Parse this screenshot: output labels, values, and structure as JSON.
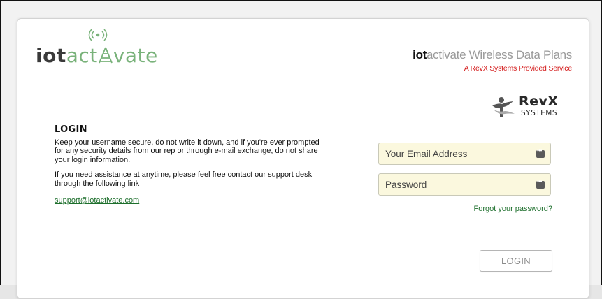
{
  "logo": {
    "part1": "iot",
    "part2": "act",
    "part3": "vate"
  },
  "brand": {
    "bold": "iot",
    "light": "activate Wireless Data Plans",
    "tagline": "A RevX Systems Provided Service",
    "partner_name": "RevX",
    "partner_sub": "SYSTEMS"
  },
  "info": {
    "title": "LOGIN",
    "paragraph1": "Keep your username secure, do not write it down, and if you're ever prompted for any security details from our rep or through e-mail exchange, do not share your login information.",
    "paragraph2": "If you need assistance at anytime, please feel free contact our support desk through the following link",
    "support_link": "support@iotactivate.com"
  },
  "form": {
    "email_placeholder": "Your Email Address",
    "email_value": "",
    "password_placeholder": "Password",
    "password_value": "",
    "forgot_link": "Forgot your password?",
    "login_button": "LOGIN"
  },
  "icons": {
    "field_icon": "keyboard-autofill-icon",
    "logo_icon": "signal-tower-icon",
    "partner_icon": "revx-figure-icon"
  },
  "colors": {
    "logo_green": "#79b27a",
    "tagline_red": "#d31818",
    "link_green": "#1c6e2b",
    "field_bg": "#fbf8de"
  }
}
